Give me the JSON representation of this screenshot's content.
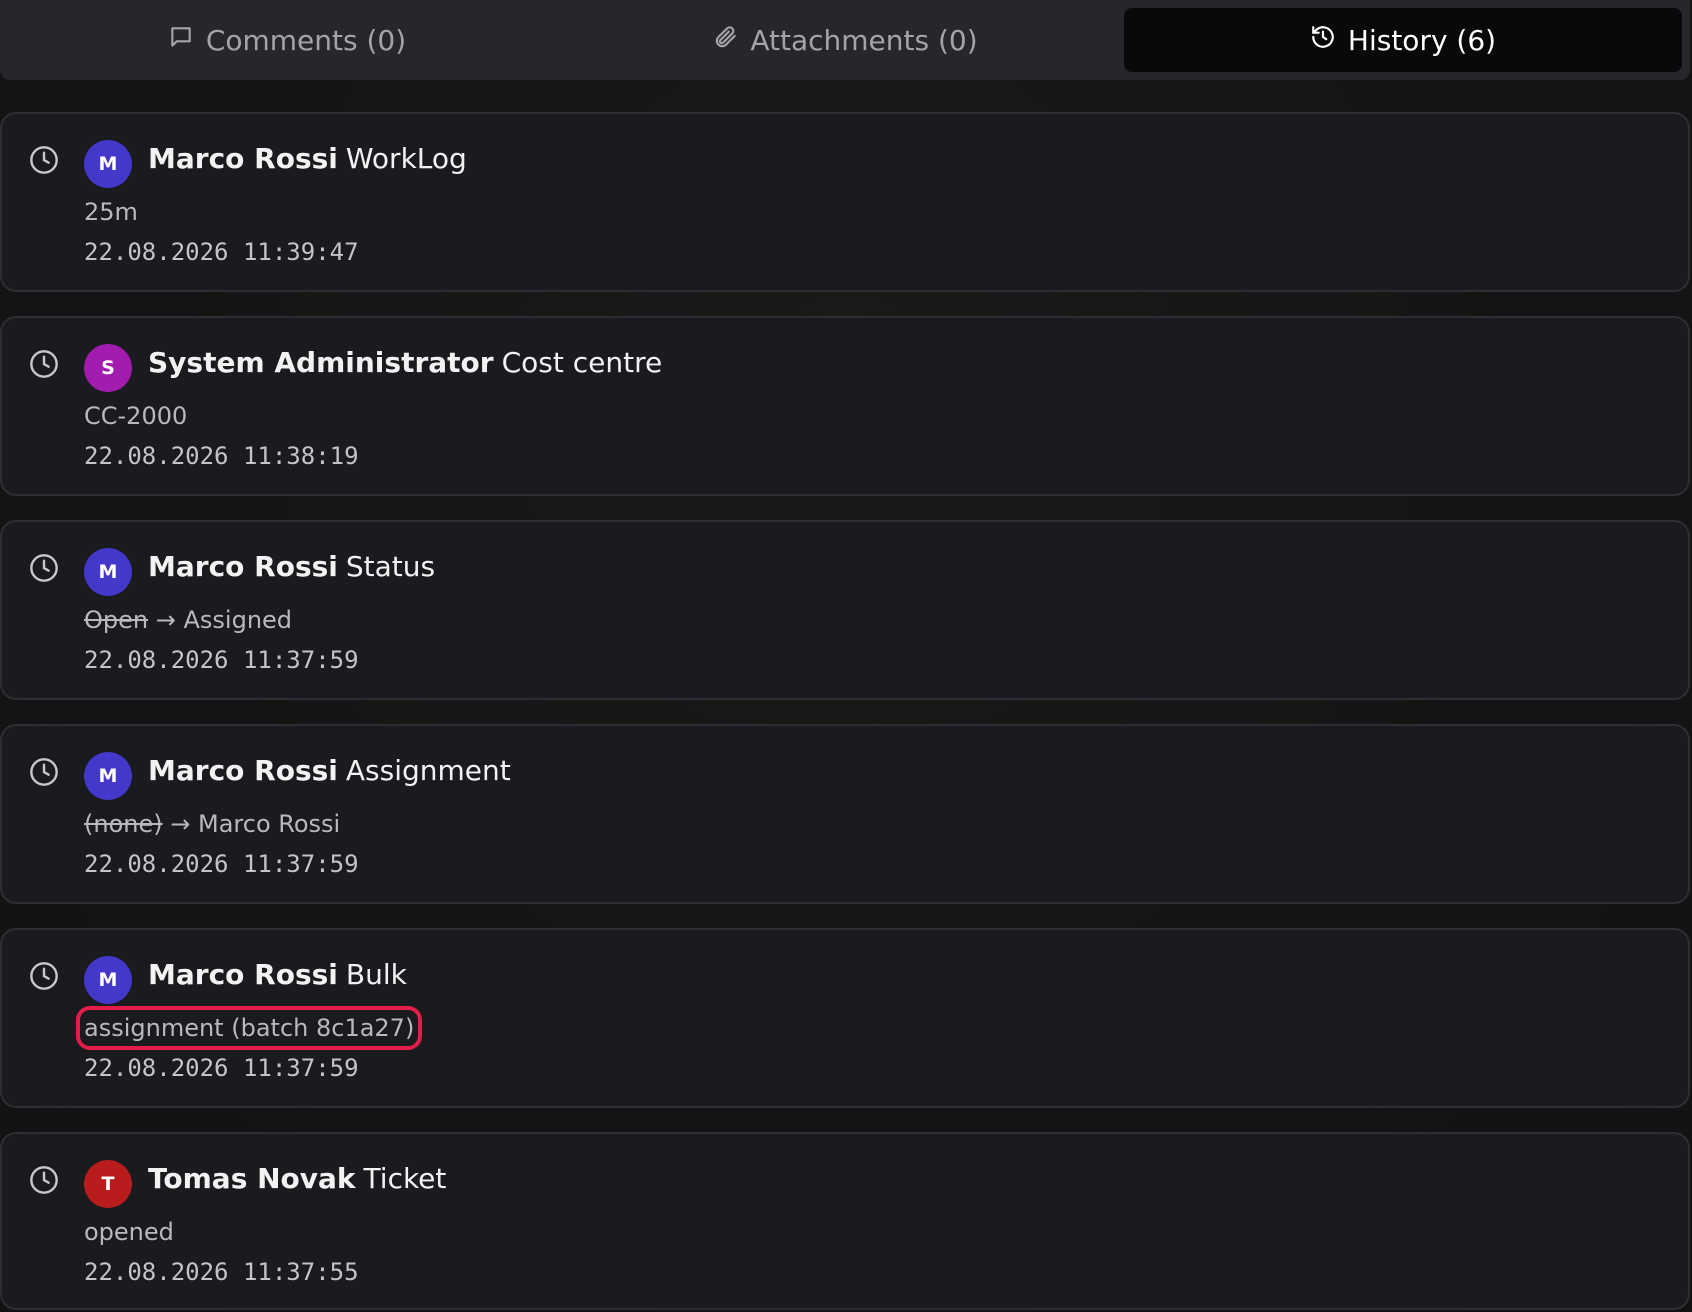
{
  "tabs": [
    {
      "label": "Comments (0)",
      "icon": "message-square-icon",
      "active": false
    },
    {
      "label": "Attachments (0)",
      "icon": "paperclip-icon",
      "active": false
    },
    {
      "label": "History (6)",
      "icon": "history-icon",
      "active": true
    }
  ],
  "colors": {
    "avatar_m": "#4338ca",
    "avatar_s": "#a21caf",
    "avatar_t": "#b91c1c",
    "highlight": "#e11d48"
  },
  "history": [
    {
      "initial": "M",
      "author": "Marco Rossi",
      "field": "WorkLog",
      "old": "",
      "arrow": "",
      "new": "25m",
      "timestamp": "22.08.2026 11:39:47"
    },
    {
      "initial": "S",
      "author": "System Administrator",
      "field": "Cost centre",
      "old": "",
      "arrow": "",
      "new": "CC-2000",
      "timestamp": "22.08.2026 11:38:19"
    },
    {
      "initial": "M",
      "author": "Marco Rossi",
      "field": "Status",
      "old": "Open",
      "arrow": "→",
      "new": "Assigned",
      "timestamp": "22.08.2026 11:37:59"
    },
    {
      "initial": "M",
      "author": "Marco Rossi",
      "field": "Assignment",
      "old": "(none)",
      "arrow": "→",
      "new": "Marco Rossi",
      "timestamp": "22.08.2026 11:37:59"
    },
    {
      "initial": "M",
      "author": "Marco Rossi",
      "field": "Bulk",
      "old": "",
      "arrow": "",
      "new": "assignment (batch 8c1a27)",
      "timestamp": "22.08.2026 11:37:59"
    },
    {
      "initial": "T",
      "author": "Tomas Novak",
      "field": "Ticket",
      "old": "",
      "arrow": "",
      "new": "opened",
      "timestamp": "22.08.2026 11:37:55"
    }
  ]
}
